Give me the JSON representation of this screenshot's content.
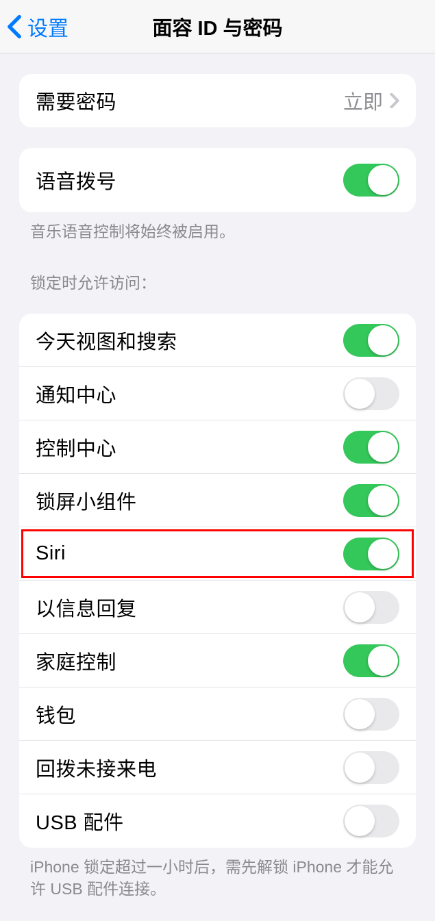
{
  "header": {
    "back_label": "设置",
    "title": "面容 ID 与密码"
  },
  "passcode_row": {
    "label": "需要密码",
    "value": "立即"
  },
  "voice_dial": {
    "label": "语音拨号",
    "footer": "音乐语音控制将始终被启用。",
    "on": true
  },
  "lock_section": {
    "header": "锁定时允许访问：",
    "items": [
      {
        "label": "今天视图和搜索",
        "on": true
      },
      {
        "label": "通知中心",
        "on": false
      },
      {
        "label": "控制中心",
        "on": true
      },
      {
        "label": "锁屏小组件",
        "on": true
      },
      {
        "label": "Siri",
        "on": true
      },
      {
        "label": "以信息回复",
        "on": false
      },
      {
        "label": "家庭控制",
        "on": true
      },
      {
        "label": "钱包",
        "on": false
      },
      {
        "label": "回拨未接来电",
        "on": false
      },
      {
        "label": "USB 配件",
        "on": false
      }
    ],
    "footer": "iPhone 锁定超过一小时后，需先解锁 iPhone 才能允许 USB 配件连接。"
  }
}
